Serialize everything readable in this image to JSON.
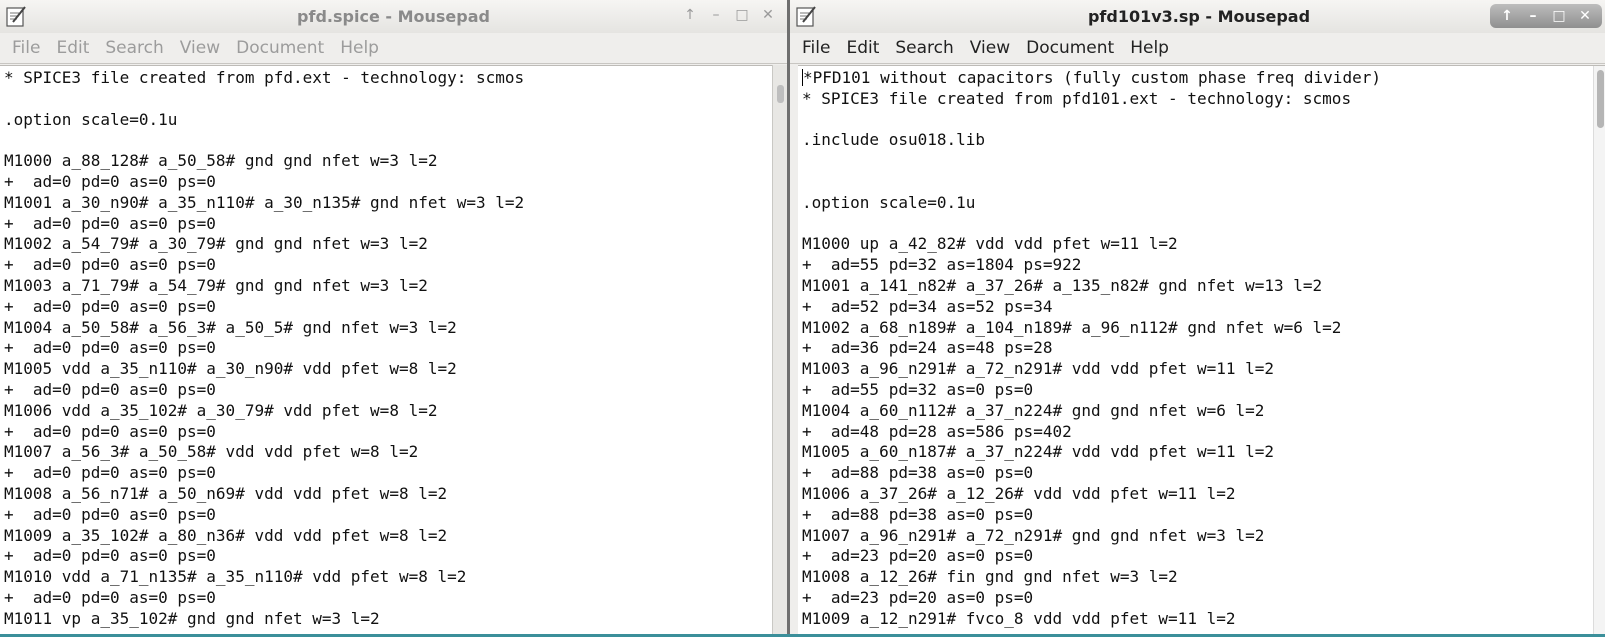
{
  "left_window": {
    "title": "pfd.spice - Mousepad",
    "menu": [
      "File",
      "Edit",
      "Search",
      "View",
      "Document",
      "Help"
    ],
    "controls": {
      "up": "↑",
      "minimize": "–",
      "maximize": "□",
      "close": "✕"
    },
    "lines": [
      "* SPICE3 file created from pfd.ext - technology: scmos",
      "",
      ".option scale=0.1u",
      "",
      "M1000 a_88_128# a_50_58# gnd gnd nfet w=3 l=2",
      "+  ad=0 pd=0 as=0 ps=0",
      "M1001 a_30_n90# a_35_n110# a_30_n135# gnd nfet w=3 l=2",
      "+  ad=0 pd=0 as=0 ps=0",
      "M1002 a_54_79# a_30_79# gnd gnd nfet w=3 l=2",
      "+  ad=0 pd=0 as=0 ps=0",
      "M1003 a_71_79# a_54_79# gnd gnd nfet w=3 l=2",
      "+  ad=0 pd=0 as=0 ps=0",
      "M1004 a_50_58# a_56_3# a_50_5# gnd nfet w=3 l=2",
      "+  ad=0 pd=0 as=0 ps=0",
      "M1005 vdd a_35_n110# a_30_n90# vdd pfet w=8 l=2",
      "+  ad=0 pd=0 as=0 ps=0",
      "M1006 vdd a_35_102# a_30_79# vdd pfet w=8 l=2",
      "+  ad=0 pd=0 as=0 ps=0",
      "M1007 a_56_3# a_50_58# vdd vdd pfet w=8 l=2",
      "+  ad=0 pd=0 as=0 ps=0",
      "M1008 a_56_n71# a_50_n69# vdd vdd pfet w=8 l=2",
      "+  ad=0 pd=0 as=0 ps=0",
      "M1009 a_35_102# a_80_n36# vdd vdd pfet w=8 l=2",
      "+  ad=0 pd=0 as=0 ps=0",
      "M1010 vdd a_71_n135# a_35_n110# vdd pfet w=8 l=2",
      "+  ad=0 pd=0 as=0 ps=0",
      "M1011 vp a_35_102# gnd gnd nfet w=3 l=2"
    ]
  },
  "right_window": {
    "title": "pfd101v3.sp - Mousepad",
    "menu": [
      "File",
      "Edit",
      "Search",
      "View",
      "Document",
      "Help"
    ],
    "controls": {
      "up": "↑",
      "minimize": "–",
      "maximize": "□",
      "close": "✕"
    },
    "lines": [
      "*PFD101 without capacitors (fully custom phase freq divider)",
      "* SPICE3 file created from pfd101.ext - technology: scmos",
      "",
      ".include osu018.lib",
      "",
      "",
      ".option scale=0.1u",
      "",
      "M1000 up a_42_82# vdd vdd pfet w=11 l=2",
      "+  ad=55 pd=32 as=1804 ps=922",
      "M1001 a_141_n82# a_37_26# a_135_n82# gnd nfet w=13 l=2",
      "+  ad=52 pd=34 as=52 ps=34",
      "M1002 a_68_n189# a_104_n189# a_96_n112# gnd nfet w=6 l=2",
      "+  ad=36 pd=24 as=48 ps=28",
      "M1003 a_96_n291# a_72_n291# vdd vdd pfet w=11 l=2",
      "+  ad=55 pd=32 as=0 ps=0",
      "M1004 a_60_n112# a_37_n224# gnd gnd nfet w=6 l=2",
      "+  ad=48 pd=28 as=586 ps=402",
      "M1005 a_60_n187# a_37_n224# vdd vdd pfet w=11 l=2",
      "+  ad=88 pd=38 as=0 ps=0",
      "M1006 a_37_26# a_12_26# vdd vdd pfet w=11 l=2",
      "+  ad=88 pd=38 as=0 ps=0",
      "M1007 a_96_n291# a_72_n291# gnd gnd nfet w=3 l=2",
      "+  ad=23 pd=20 as=0 ps=0",
      "M1008 a_12_26# fin gnd gnd nfet w=3 l=2",
      "+  ad=23 pd=20 as=0 ps=0",
      "M1009 a_12_n291# fvco_8 vdd vdd pfet w=11 l=2"
    ]
  }
}
